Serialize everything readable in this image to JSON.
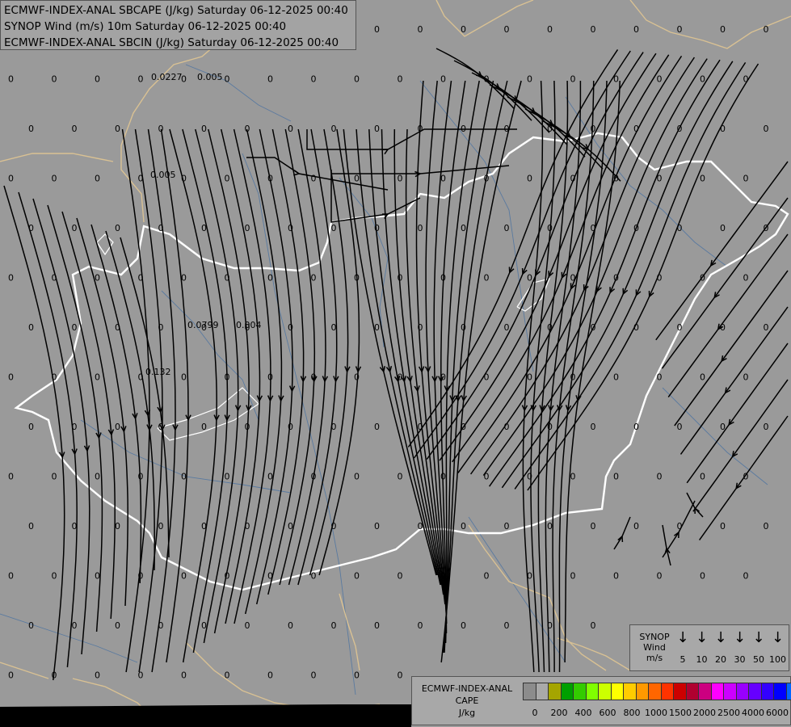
{
  "header": {
    "line1": "ECMWF-INDEX-ANAL SBCAPE (J/kg) Saturday 06-12-2025 00:40",
    "line2": "SYNOP Wind (m/s) 10m Saturday 06-12-2025 00:40",
    "line3": "ECMWF-INDEX-ANAL SBCIN (J/kg) Saturday 06-12-2025 00:40"
  },
  "wind_legend": {
    "title_line1": "SYNOP",
    "title_line2": "Wind",
    "title_line3": "m/s",
    "arrow_glyph": "↓",
    "speeds": [
      "5",
      "10",
      "20",
      "30",
      "50",
      "100"
    ]
  },
  "cape_legend": {
    "title_line1": "ECMWF-INDEX-ANAL",
    "title_line2": "CAPE",
    "title_line3": "J/kg",
    "colors": [
      "#8c8c8c",
      "#a9a9a9",
      "#a5a500",
      "#00a000",
      "#33cc00",
      "#80ff00",
      "#ccff00",
      "#ffff00",
      "#ffcc00",
      "#ff9900",
      "#ff6600",
      "#ff3300",
      "#cc0000",
      "#b00030",
      "#cc0080",
      "#ff00ff",
      "#cc00ff",
      "#9900ff",
      "#6600ff",
      "#3300ff",
      "#0000ff",
      "#0066ff",
      "#00ccff",
      "#00ffff",
      "#b3ffff",
      "#ffffff"
    ],
    "labels": [
      "0",
      "200",
      "400",
      "600",
      "800",
      "1000",
      "1500",
      "2000",
      "2500",
      "4000",
      "6000"
    ]
  },
  "annotations": [
    "0.0227",
    "0.005",
    "0.005",
    "0.0799",
    "0.004",
    "0.132",
    "0",
    "0",
    "0",
    "0",
    "0",
    "0",
    "0",
    "0",
    "0",
    "0",
    "0",
    "0",
    "0",
    "0",
    "0",
    "0",
    "0",
    "0",
    "0",
    "0",
    "0",
    "0",
    "0",
    "0"
  ],
  "colors": {
    "background": "#9a9a9a",
    "streamline": "#000000",
    "border": "#ffffff",
    "coast": "#d9c193",
    "river": "#5a7aa0"
  }
}
